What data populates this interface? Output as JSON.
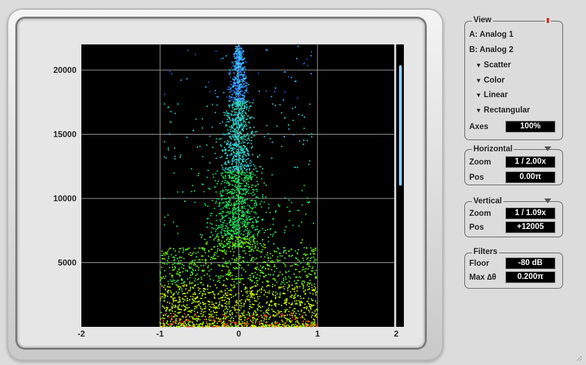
{
  "view": {
    "title": "View",
    "pause_glyph": "II",
    "channel_a": "A: Analog 1",
    "channel_b": "B: Analog 2",
    "menus": [
      "Scatter",
      "Color",
      "Linear",
      "Rectangular"
    ],
    "axes_label": "Axes",
    "axes_value": "100%"
  },
  "horizontal": {
    "title": "Horizontal",
    "zoom_label": "Zoom",
    "zoom_value": "1 / 2.00x",
    "pos_label": "Pos",
    "pos_value": "0.00π"
  },
  "vertical": {
    "title": "Vertical",
    "zoom_label": "Zoom",
    "zoom_value": "1 / 1.09x",
    "pos_label": "Pos",
    "pos_value": "+12005"
  },
  "filters": {
    "title": "Filters",
    "floor_label": "Floor",
    "floor_value": "-80 dB",
    "max_label": "Max ∆θ",
    "max_value": "0.200π"
  },
  "chart_data": {
    "type": "scatter",
    "x_ticks": [
      "-2",
      "-1",
      "0",
      "1",
      "2"
    ],
    "y_ticks": [
      "5000",
      "10000",
      "15000",
      "20000"
    ],
    "xlim": [
      -2,
      2
    ],
    "ylim": [
      0,
      22000
    ],
    "grid": true,
    "scrollbar_fraction": 0.5,
    "point_cloud": {
      "x_extent": [
        -1,
        1
      ],
      "y_max": 22000,
      "description_colors": [
        "#1a4bd6",
        "#2fd0e6",
        "#27e84a",
        "#c8f000",
        "#ff3a10"
      ]
    }
  }
}
